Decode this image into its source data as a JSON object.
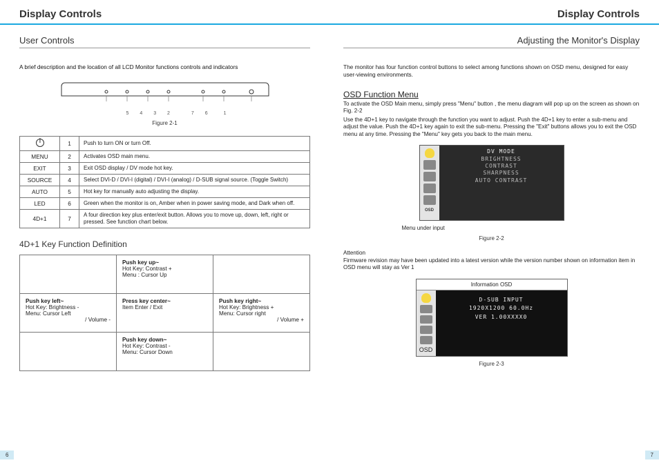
{
  "left": {
    "header": "Display Controls",
    "sub": "User Controls",
    "intro": "A brief description and the location of all LCD Monitor functions controls and indicators",
    "fig1_caption": "Figure 2-1",
    "fig1_labels": [
      "5",
      "4",
      "3",
      "2",
      "7",
      "6",
      "1"
    ],
    "controls": [
      {
        "label": "",
        "num": "1",
        "desc": "Push to turn ON or turn Off."
      },
      {
        "label": "MENU",
        "num": "2",
        "desc": "Activates OSD main menu."
      },
      {
        "label": "EXIT",
        "num": "3",
        "desc": "Exit OSD display / DV mode hot key."
      },
      {
        "label": "SOURCE",
        "num": "4",
        "desc": "Select DVI-D / DVI-I (digital) / DVI-I (analog) / D-SUB signal source. (Toggle Switch)"
      },
      {
        "label": "AUTO",
        "num": "5",
        "desc": "Hot key for manually auto adjusting the display."
      },
      {
        "label": "LED",
        "num": "6",
        "desc": "Green when the monitor is on, Amber when in power saving mode, and Dark when off."
      },
      {
        "label": "4D+1",
        "num": "7",
        "desc": "A four direction key plus enter/exit button. Allows you to move up, down, left, right or pressed. See function chart below."
      }
    ],
    "keyfn_heading": "4D+1 Key Function Definition",
    "keyfn": {
      "up": {
        "t": "Push key up~",
        "l1": "Hot Key: Contrast +",
        "l2": "Menu : Cursor Up",
        "l3": ""
      },
      "left": {
        "t": "Push key left~",
        "l1": "Hot Key: Brightness -",
        "l2": "Menu: Cursor Left",
        "l3": "/ Volume -"
      },
      "center": {
        "t": "Press key center~",
        "l1": "Item Enter / Exit",
        "l2": "",
        "l3": ""
      },
      "right": {
        "t": "Push key right~",
        "l1": "Hot Key: Brightness +",
        "l2": "Menu: Cursor right",
        "l3": "/ Volume +"
      },
      "down": {
        "t": "Push key down~",
        "l1": "Hot Key: Contrast -",
        "l2": "Menu: Cursor Down",
        "l3": ""
      }
    },
    "page_num": "6"
  },
  "right": {
    "header": "Display Controls",
    "sub": "Adjusting the Monitor's Display",
    "intro": "The monitor has four function control buttons to select among functions shown on OSD menu, designed for easy  user-viewing environments.",
    "osd_heading": "OSD Function Menu",
    "osd_p1": "To activate the OSD Main menu, simply press \"Menu\" button , the menu diagram will pop up on the screen as shown on Fig. 2-2",
    "osd_p2": "Use the 4D+1 key to navigate through the function you want to adjust. Push the 4D+1 key to enter a sub-menu and adjust the value. Push the 4D+1 key again to exit the sub-menu. Pressing the \"Exit\" buttons allows you to exit the OSD menu at any time. Pressing the \"Menu\" key gets you back to the main menu.",
    "osd_items": [
      "DV MODE",
      "BRIGHTNESS",
      "CONTRAST",
      "SHARPNESS",
      "AUTO CONTRAST"
    ],
    "osd_tag": "OSD",
    "under_note": "Menu under input",
    "fig2_caption": "Figure 2-2",
    "att_h": "Attention",
    "att_p": "Firmware revision may have been updated into a latest version while the version number shown on information item in OSD menu will stay as Ver 1",
    "info_title": "Information OSD",
    "info_lines": [
      "D-SUB  INPUT",
      "1920X1200  60.0Hz",
      "VER  1.00XXXX0"
    ],
    "fig3_caption": "Figure 2-3",
    "page_num": "7"
  }
}
